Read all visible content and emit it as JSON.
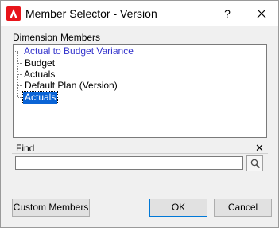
{
  "window": {
    "title": "Member Selector - Version",
    "help_glyph": "?",
    "app_icon_letter": "A"
  },
  "dimension": {
    "label": "Dimension Members",
    "tree": [
      {
        "label": "Actual to Budget Variance",
        "level": 0,
        "selected": false
      },
      {
        "label": "Budget",
        "level": 1,
        "selected": false
      },
      {
        "label": "Actuals",
        "level": 1,
        "selected": false
      },
      {
        "label": "Default Plan (Version)",
        "level": 1,
        "selected": false
      },
      {
        "label": "Actuals",
        "level": 1,
        "selected": true
      }
    ]
  },
  "find": {
    "label": "Find",
    "value": "",
    "placeholder": "",
    "close_glyph": "✕"
  },
  "buttons": {
    "custom_members": "Custom Members",
    "ok": "OK",
    "cancel": "Cancel"
  },
  "colors": {
    "selection": "#0a64d6",
    "root_text": "#3333cc",
    "app_icon": "#e8141a"
  }
}
